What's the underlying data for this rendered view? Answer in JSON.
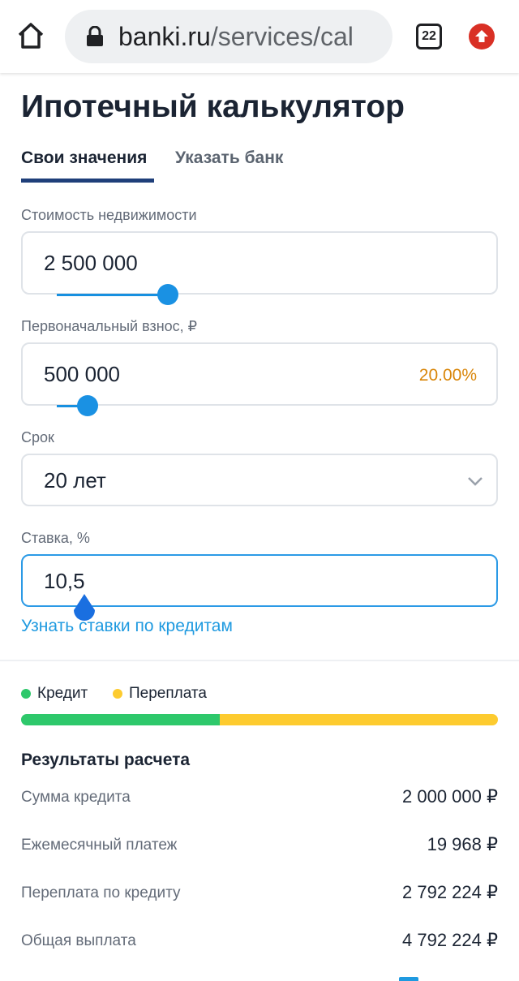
{
  "browser": {
    "url_host": "banki.ru",
    "url_path": "/services/cal",
    "tab_count": "22"
  },
  "page": {
    "title": "Ипотечный калькулятор",
    "tabs": [
      {
        "label": "Свои значения",
        "active": true
      },
      {
        "label": "Указать банк",
        "active": false
      }
    ]
  },
  "form": {
    "price": {
      "label": "Стоимость недвижимости",
      "value": "2 500 000"
    },
    "down_payment": {
      "label": "Первоначальный взнос, ₽",
      "value": "500 000",
      "percent": "20.00%"
    },
    "term": {
      "label": "Срок",
      "value": "20 лет"
    },
    "rate": {
      "label": "Ставка, %",
      "value": "10,5"
    },
    "rates_link": "Узнать ставки по кредитам"
  },
  "legend": {
    "credit": {
      "label": "Кредит",
      "color": "#2ec86b"
    },
    "overpay": {
      "label": "Переплата",
      "color": "#fdcb2f"
    }
  },
  "breakdown_bar": {
    "credit_share": 0.417,
    "overpay_share": 0.583
  },
  "results": {
    "title": "Результаты расчета",
    "rows": [
      {
        "label": "Сумма кредита",
        "value": "2 000 000 ₽"
      },
      {
        "label": "Ежемесячный платеж",
        "value": "19 968 ₽"
      },
      {
        "label": "Переплата по кредиту",
        "value": "2 792 224 ₽"
      },
      {
        "label": "Общая выплата",
        "value": "4 792 224 ₽"
      }
    ]
  }
}
